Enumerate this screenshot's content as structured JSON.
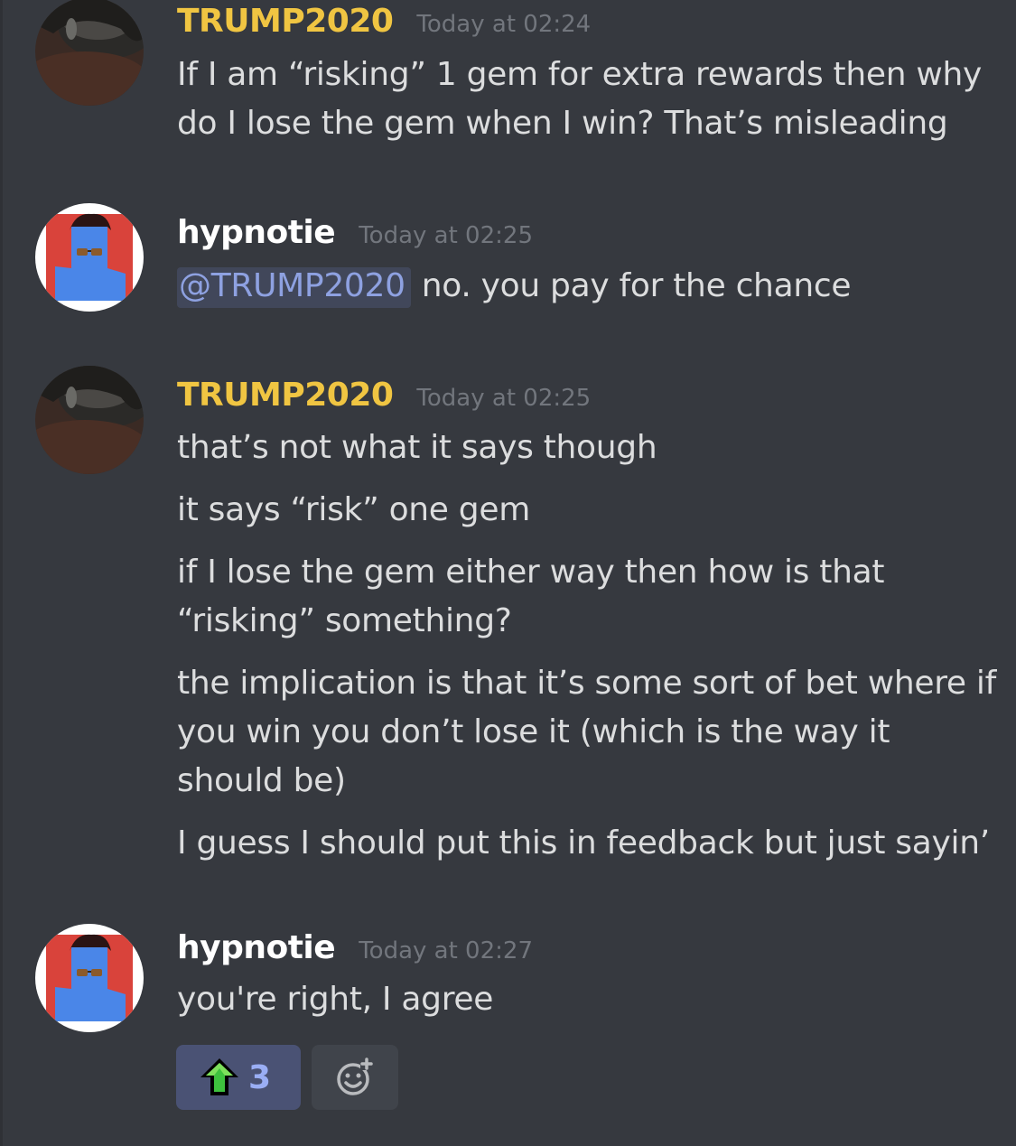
{
  "messages": [
    {
      "author": "TRUMP2020",
      "timestamp": "Today at 02:24",
      "lines": [
        "If I am “risking” 1 gem for extra rewards then why",
        "do I lose the gem when I win? That’s misleading"
      ]
    },
    {
      "author": "hypnotie",
      "timestamp": "Today at 02:25",
      "mention": "@TRUMP2020",
      "text": "no. you pay for the chance"
    },
    {
      "author": "TRUMP2020",
      "timestamp": "Today at 02:25",
      "lines": [
        "that’s not what it says though",
        "it says “risk” one gem",
        "if I lose the gem either way then how is that",
        "“risking” something?",
        "the implication is that it’s some sort of bet where if",
        "you win you don’t lose it (which is the way it",
        "should be)",
        "I guess I should put this in feedback but just sayin’"
      ]
    },
    {
      "author": "hypnotie",
      "timestamp": "Today at 02:27",
      "lines": [
        "you're right, I agree"
      ],
      "reactions": [
        {
          "emoji": "green-up-arrow-icon",
          "count": "3"
        }
      ]
    }
  ],
  "colors": {
    "background": "#36393f",
    "username_trump": "#f0c542",
    "username_hypnotie": "#ffffff",
    "timestamp": "#72767d",
    "text": "#dcddde",
    "mention": "#8ea1e1",
    "reaction_active_bg": "#4a5274",
    "reaction_count": "#9aaef5"
  }
}
